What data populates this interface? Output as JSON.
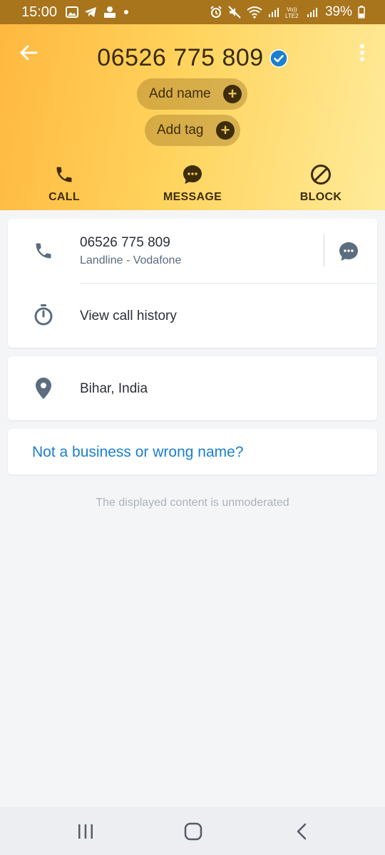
{
  "status_bar": {
    "time": "15:00",
    "battery_percent": "39%",
    "icons_left": [
      "gallery-icon",
      "telegram-icon",
      "app-notification-icon",
      "dot-icon"
    ],
    "icons_right": [
      "alarm-icon",
      "mute-icon",
      "wifi-icon",
      "signal-icon",
      "volte-icon",
      "signal-icon",
      "battery-icon"
    ],
    "volte_label": "Vo)) LTE2"
  },
  "header": {
    "title": "06526 775 809",
    "add_name_label": "Add name",
    "add_tag_label": "Add tag",
    "actions": [
      {
        "id": "call",
        "label": "CALL",
        "icon": "phone-icon"
      },
      {
        "id": "message",
        "label": "MESSAGE",
        "icon": "message-icon"
      },
      {
        "id": "block",
        "label": "BLOCK",
        "icon": "block-icon"
      }
    ]
  },
  "contact_card": {
    "phone_number": "06526 775 809",
    "carrier": "Landline - Vodafone",
    "call_history_label": "View call history"
  },
  "location_card": {
    "location": "Bihar, India"
  },
  "report_card": {
    "link_text": "Not a business or wrong name?"
  },
  "disclaimer": "The displayed content is unmoderated",
  "colors": {
    "status_bar": "#a8741c",
    "header_gradient_start": "#ffb840",
    "header_gradient_end": "#ffeb9a",
    "header_text": "#3d2d0a",
    "verified_badge": "#1a7fd0",
    "link": "#1a7fd0",
    "icon_slate": "#5b6d7e",
    "background": "#f4f5f7"
  },
  "nav_bar": {
    "buttons": [
      "recents-icon",
      "home-icon",
      "back-icon"
    ]
  }
}
